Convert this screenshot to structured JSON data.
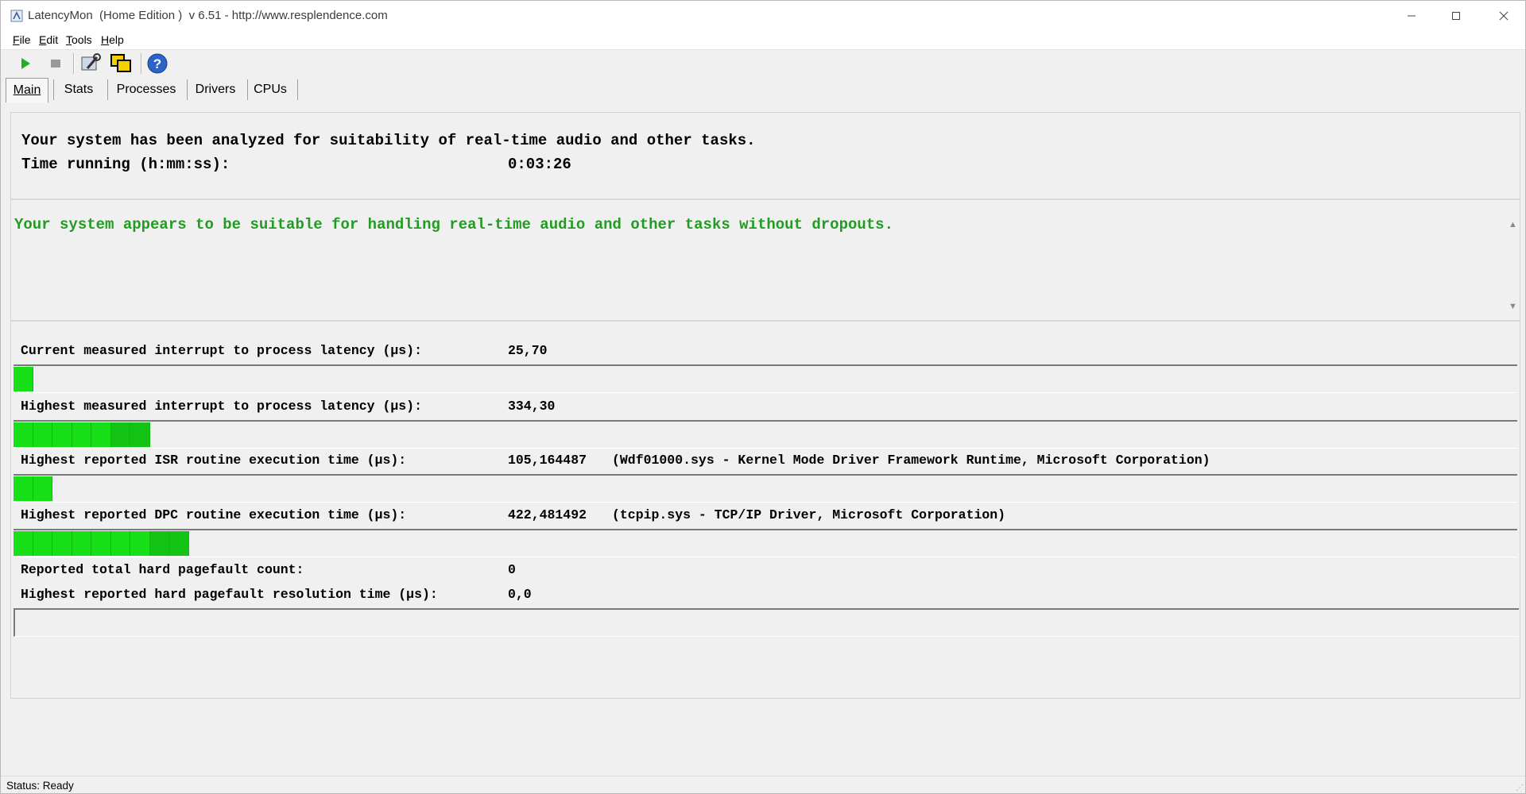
{
  "window": {
    "title": "LatencyMon  (Home Edition )  v 6.51 - http://www.resplendence.com"
  },
  "menu": [
    {
      "label": "File",
      "u": "F",
      "rest": "ile"
    },
    {
      "label": "Edit",
      "u": "E",
      "rest": "dit"
    },
    {
      "label": "Tools",
      "u": "T",
      "rest": "ools"
    },
    {
      "label": "Help",
      "u": "H",
      "rest": "elp"
    }
  ],
  "toolbar": {
    "play": "play-icon",
    "stop": "stop-icon",
    "tool1": "wrench-settings-icon",
    "tool2": "windows-copy-icon",
    "help": "help-icon"
  },
  "tabs": [
    "Main",
    "Stats",
    "Processes",
    "Drivers",
    "CPUs"
  ],
  "main": {
    "analyzed": "Your system has been analyzed for suitability of real-time audio and other tasks.",
    "time_label": "Time running (h:mm:ss):",
    "time_value": "0:03:26",
    "verdict": "Your system appears to be suitable for handling real-time audio and other tasks without dropouts.",
    "verdict_color": "#239a23",
    "metrics": {
      "current": {
        "label": "Current measured interrupt to process latency (µs):",
        "value": "25,70",
        "bar_segments": 1
      },
      "highest": {
        "label": "Highest measured interrupt to process latency (µs):",
        "value": "334,30",
        "bar_segments": 7
      },
      "isr": {
        "label": "Highest reported ISR routine execution time (µs):",
        "value": "105,164487",
        "extra": "(Wdf01000.sys - Kernel Mode Driver Framework Runtime, Microsoft Corporation)",
        "bar_segments": 2
      },
      "dpc": {
        "label": "Highest reported DPC routine execution time (µs):",
        "value": "422,481492",
        "extra": "(tcpip.sys - TCP/IP Driver, Microsoft Corporation)",
        "bar_segments": 9
      },
      "pagefault_count": {
        "label": "Reported total hard pagefault count:",
        "value": "0"
      },
      "pagefault_time": {
        "label": "Highest reported hard pagefault resolution time (µs):",
        "value": "0,0",
        "bar_segments": 0
      }
    },
    "bar_color": "#18e018"
  },
  "status": {
    "text": "Status: Ready"
  }
}
